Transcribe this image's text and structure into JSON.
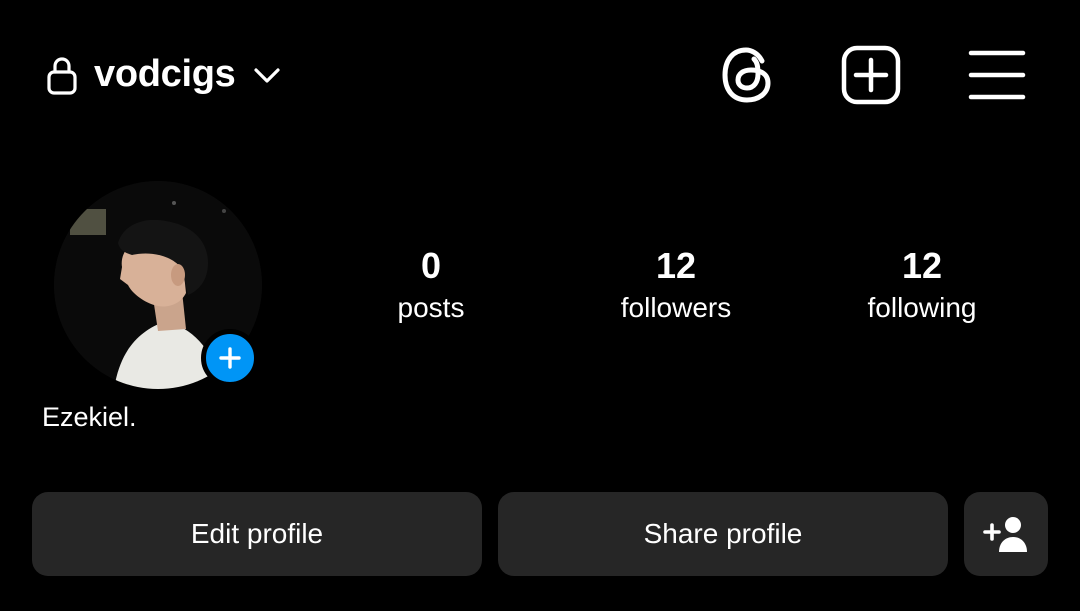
{
  "header": {
    "username": "vodcigs",
    "icons": [
      "lock-icon",
      "chevron-down-icon",
      "threads-icon",
      "create-icon",
      "menu-icon"
    ]
  },
  "profile": {
    "display_name": "Ezekiel.",
    "stats": {
      "posts": {
        "value": "0",
        "label": "posts"
      },
      "followers": {
        "value": "12",
        "label": "followers"
      },
      "following": {
        "value": "12",
        "label": "following"
      }
    }
  },
  "actions": {
    "edit_label": "Edit profile",
    "share_label": "Share profile"
  },
  "colors": {
    "background": "#000000",
    "button": "#262626",
    "accent": "#0095f6",
    "text": "#ffffff"
  }
}
